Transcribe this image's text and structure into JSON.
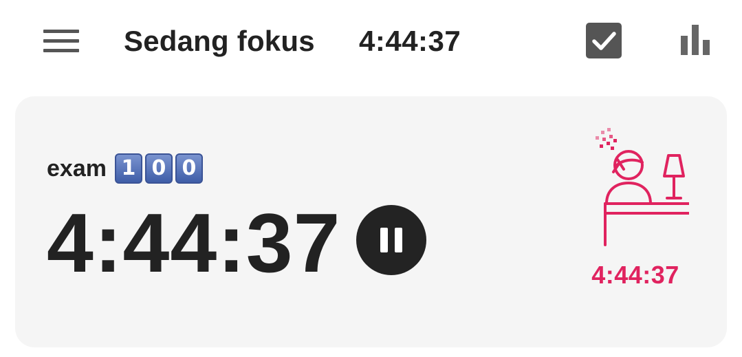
{
  "header": {
    "title": "Sedang fokus",
    "timer": "4:44:37",
    "menu_icon": "hamburger-menu-icon",
    "check_icon": "checkbox-checked-icon",
    "stats_icon": "bar-chart-icon"
  },
  "session": {
    "task_name": "exam",
    "task_emoji_digits": [
      "1",
      "0",
      "0"
    ],
    "elapsed": "4:44:37",
    "pause_icon": "pause-icon",
    "illustration_icon": "studying-person-icon",
    "illustration_timer": "4:44:37"
  },
  "colors": {
    "accent": "#e0235f",
    "card_background": "#f5f5f5",
    "text": "#222222",
    "check_box": "#555555",
    "keycap_blue": "#4a68b0"
  }
}
